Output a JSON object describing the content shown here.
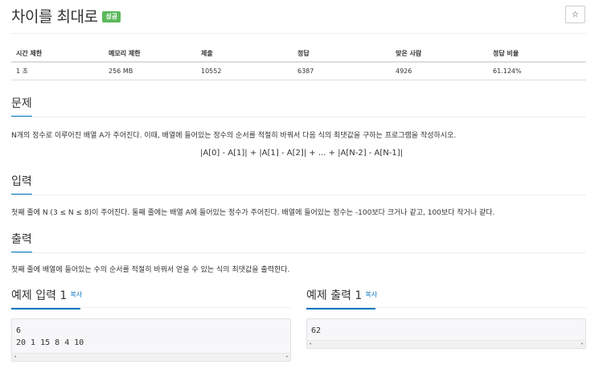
{
  "problem": {
    "title": "차이를 최대로",
    "status_badge": "성공",
    "star_icon": "☆"
  },
  "info_table": {
    "headers": [
      "시간 제한",
      "메모리 제한",
      "제출",
      "정답",
      "맞은 사람",
      "정답 비율"
    ],
    "values": [
      "1 초",
      "256 MB",
      "10552",
      "6387",
      "4926",
      "61.124%"
    ]
  },
  "sections": {
    "problem": {
      "heading": "문제",
      "text": "N개의 정수로 이루어진 배열 A가 주어진다. 이때, 배열에 들어있는 정수의 순서를 적절히 바꿔서 다음 식의 최댓값을 구하는 프로그램을 작성하시오.",
      "formula": "|A[0] - A[1]| + |A[1] - A[2]| + ... + |A[N-2] - A[N-1]|"
    },
    "input": {
      "heading": "입력",
      "text": "첫째 줄에 N (3 ≤ N ≤ 8)이 주어진다. 둘째 줄에는 배열 A에 들어있는 정수가 주어진다. 배열에 들어있는 정수는 -100보다 크거나 같고, 100보다 작거나 같다."
    },
    "output": {
      "heading": "출력",
      "text": "첫째 줄에 배열에 들어있는 수의 순서를 적절히 바꿔서 얻을 수 있는 식의 최댓값을 출력한다."
    }
  },
  "samples": {
    "input": {
      "heading": "예제 입력 1",
      "copy_label": "복사",
      "line1": "6",
      "line2": "20 1 15 8 4 10"
    },
    "output": {
      "heading": "예제 출력 1",
      "copy_label": "복사",
      "line1": "62"
    },
    "scroll_left": "◂",
    "scroll_right": "▸"
  }
}
